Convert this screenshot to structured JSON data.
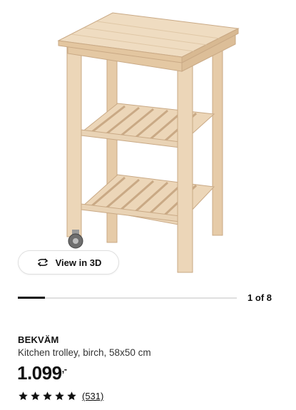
{
  "gallery": {
    "image_alt": "BEKVÄM kitchen trolley",
    "view3d_label": "View in 3D",
    "counter": "1 of 8",
    "progress_fraction": 0.125
  },
  "product": {
    "name": "BEKVÄM",
    "description": "Kitchen trolley, birch, 58x50 cm",
    "price_main": "1.099",
    "price_suffix": ",-",
    "rating": 5,
    "review_count": "(531)"
  },
  "colors": {
    "wood": "#e9d3b5",
    "wood_dark": "#cfb08b",
    "text": "#111111",
    "divider": "#dfdfdf"
  },
  "icons": {
    "view3d": "rotate-3d-icon",
    "star": "star-icon"
  }
}
